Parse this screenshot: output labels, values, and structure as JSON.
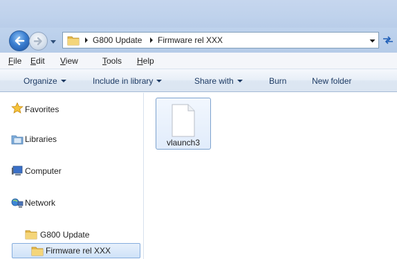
{
  "address_bar": {
    "breadcrumbs": [
      "G800 Update",
      "Firmware rel XXX"
    ]
  },
  "menu": {
    "items": [
      {
        "label": "File",
        "access_key": "F",
        "rest": "ile"
      },
      {
        "label": "Edit",
        "access_key": "E",
        "rest": "dit"
      },
      {
        "label": "View",
        "access_key": "V",
        "rest": "iew"
      },
      {
        "label": "Tools",
        "access_key": "T",
        "rest": "ools"
      },
      {
        "label": "Help",
        "access_key": "H",
        "rest": "elp"
      }
    ]
  },
  "toolbar": {
    "organize": "Organize",
    "include_in_library": "Include in library",
    "share_with": "Share with",
    "burn": "Burn",
    "new_folder": "New folder"
  },
  "navigation": {
    "favorites": "Favorites",
    "libraries": "Libraries",
    "computer": "Computer",
    "network": "Network",
    "folder_parent": "G800 Update",
    "folder_selected": "Firmware rel XXX"
  },
  "files": [
    {
      "name": "vlaunch3",
      "icon": "blank-file-icon"
    }
  ],
  "colors": {
    "chrome": "#bfd2ec",
    "selection": "#cfe2f8",
    "selection_border": "#84acdd",
    "command_text": "#1e3b64"
  }
}
